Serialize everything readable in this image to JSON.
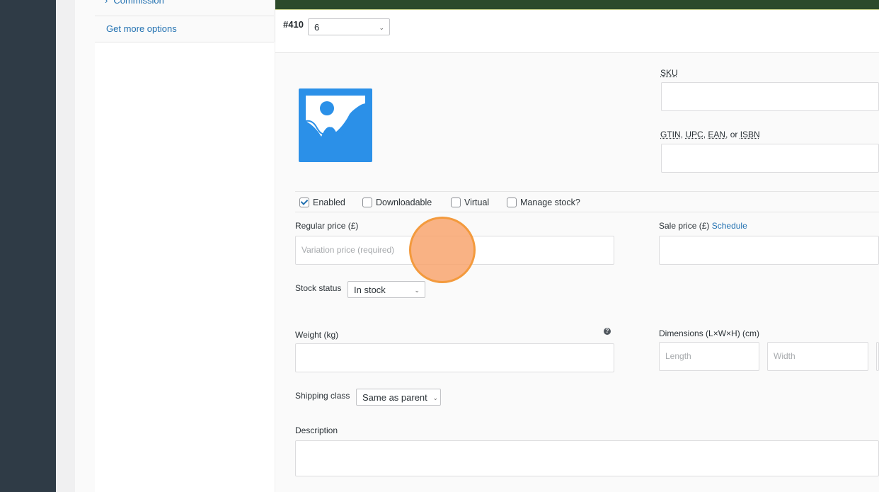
{
  "sidebar": {
    "partial_tab_label": "Commission",
    "get_more_options": "Get more options"
  },
  "variation": {
    "id_label": "#410",
    "selected_value": "6"
  },
  "fields": {
    "sku_label": "SKU",
    "gtin_label_parts": [
      "GTIN",
      "UPC",
      "EAN",
      "ISBN"
    ],
    "gtin_separator_1": ", ",
    "gtin_separator_2": ", ",
    "gtin_separator_3": ", or ",
    "regular_price_label": "Regular price (£)",
    "regular_price_placeholder": "Variation price (required)",
    "sale_price_label": "Sale price (£)",
    "sale_schedule_link": "Schedule",
    "stock_status_label": "Stock status",
    "stock_status_value": "In stock",
    "weight_label": "Weight (kg)",
    "dimensions_label": "Dimensions (L×W×H) (cm)",
    "length_placeholder": "Length",
    "width_placeholder": "Width",
    "shipping_class_label": "Shipping class",
    "shipping_class_value": "Same as parent",
    "description_label": "Description"
  },
  "options": {
    "enabled": "Enabled",
    "downloadable": "Downloadable",
    "virtual": "Virtual",
    "manage_stock": "Manage stock?"
  },
  "states": {
    "enabled_checked": true,
    "downloadable_checked": false,
    "virtual_checked": false,
    "manage_stock_checked": false
  },
  "colors": {
    "link": "#2271b1",
    "image_placeholder": "#2b90e8",
    "cursor_highlight": "#f39a3d",
    "admin_bar": "#2f3b46"
  }
}
